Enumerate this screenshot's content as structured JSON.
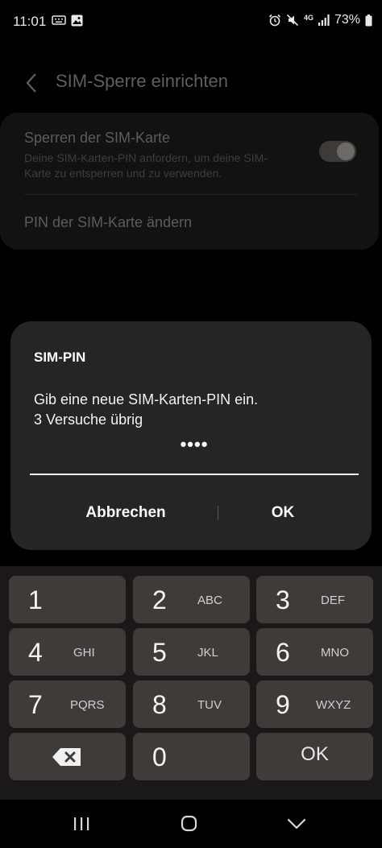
{
  "status_bar": {
    "time": "11:01",
    "network": "4G",
    "battery": "73%"
  },
  "page": {
    "title": "SIM-Sperre einrichten",
    "lock_sim": {
      "title": "Sperren der SIM-Karte",
      "description": "Deine SIM-Karten-PIN anfordern, um deine SIM-Karte zu entsperren und zu verwenden.",
      "enabled": true
    },
    "change_pin_label": "PIN der SIM-Karte ändern"
  },
  "dialog": {
    "title": "SIM-PIN",
    "message_line1": "Gib eine neue SIM-Karten-PIN ein.",
    "message_line2": "3 Versuche übrig",
    "pin_masked": "••••",
    "cancel_label": "Abbrechen",
    "ok_label": "OK"
  },
  "keypad": {
    "keys": [
      {
        "num": "1",
        "letters": ""
      },
      {
        "num": "2",
        "letters": "ABC"
      },
      {
        "num": "3",
        "letters": "DEF"
      },
      {
        "num": "4",
        "letters": "GHI"
      },
      {
        "num": "5",
        "letters": "JKL"
      },
      {
        "num": "6",
        "letters": "MNO"
      },
      {
        "num": "7",
        "letters": "PQRS"
      },
      {
        "num": "8",
        "letters": "TUV"
      },
      {
        "num": "9",
        "letters": "WXYZ"
      },
      {
        "num": "0",
        "letters": ""
      }
    ],
    "ok_label": "OK",
    "delete_icon": "backspace-icon"
  },
  "nav_bar": {
    "recents_icon": "recents-icon",
    "home_icon": "home-icon",
    "back_icon": "nav-back-icon"
  }
}
